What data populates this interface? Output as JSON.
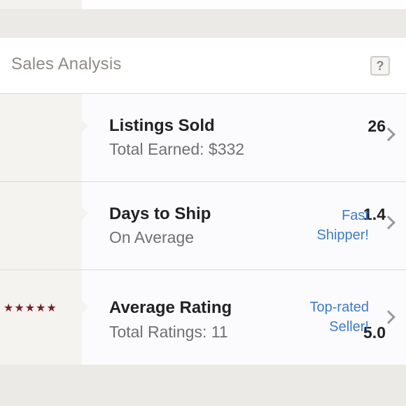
{
  "section": {
    "title": "Sales Analysis",
    "help_label": "?"
  },
  "rows": [
    {
      "value": "26",
      "title": "Listings Sold",
      "subtitle": "Total Earned: $332",
      "badge": ""
    },
    {
      "value": "1.4",
      "title": "Days to Ship",
      "subtitle": "On Average",
      "badge_line1": "Fast",
      "badge_line2": "Shipper!"
    },
    {
      "value": "5.0",
      "stars": "★★★★★",
      "rating_out_of_5": 5,
      "title": "Average Rating",
      "subtitle": "Total Ratings: 11",
      "badge_line1": "Top-rated",
      "badge_line2": "Seller!"
    }
  ],
  "colors": {
    "badge": "#3d7cc9",
    "stars": "#7a1e28",
    "title_gray": "#8f8b84"
  },
  "icons": [
    "help-icon",
    "chevron-right-icon",
    "star-icon"
  ]
}
